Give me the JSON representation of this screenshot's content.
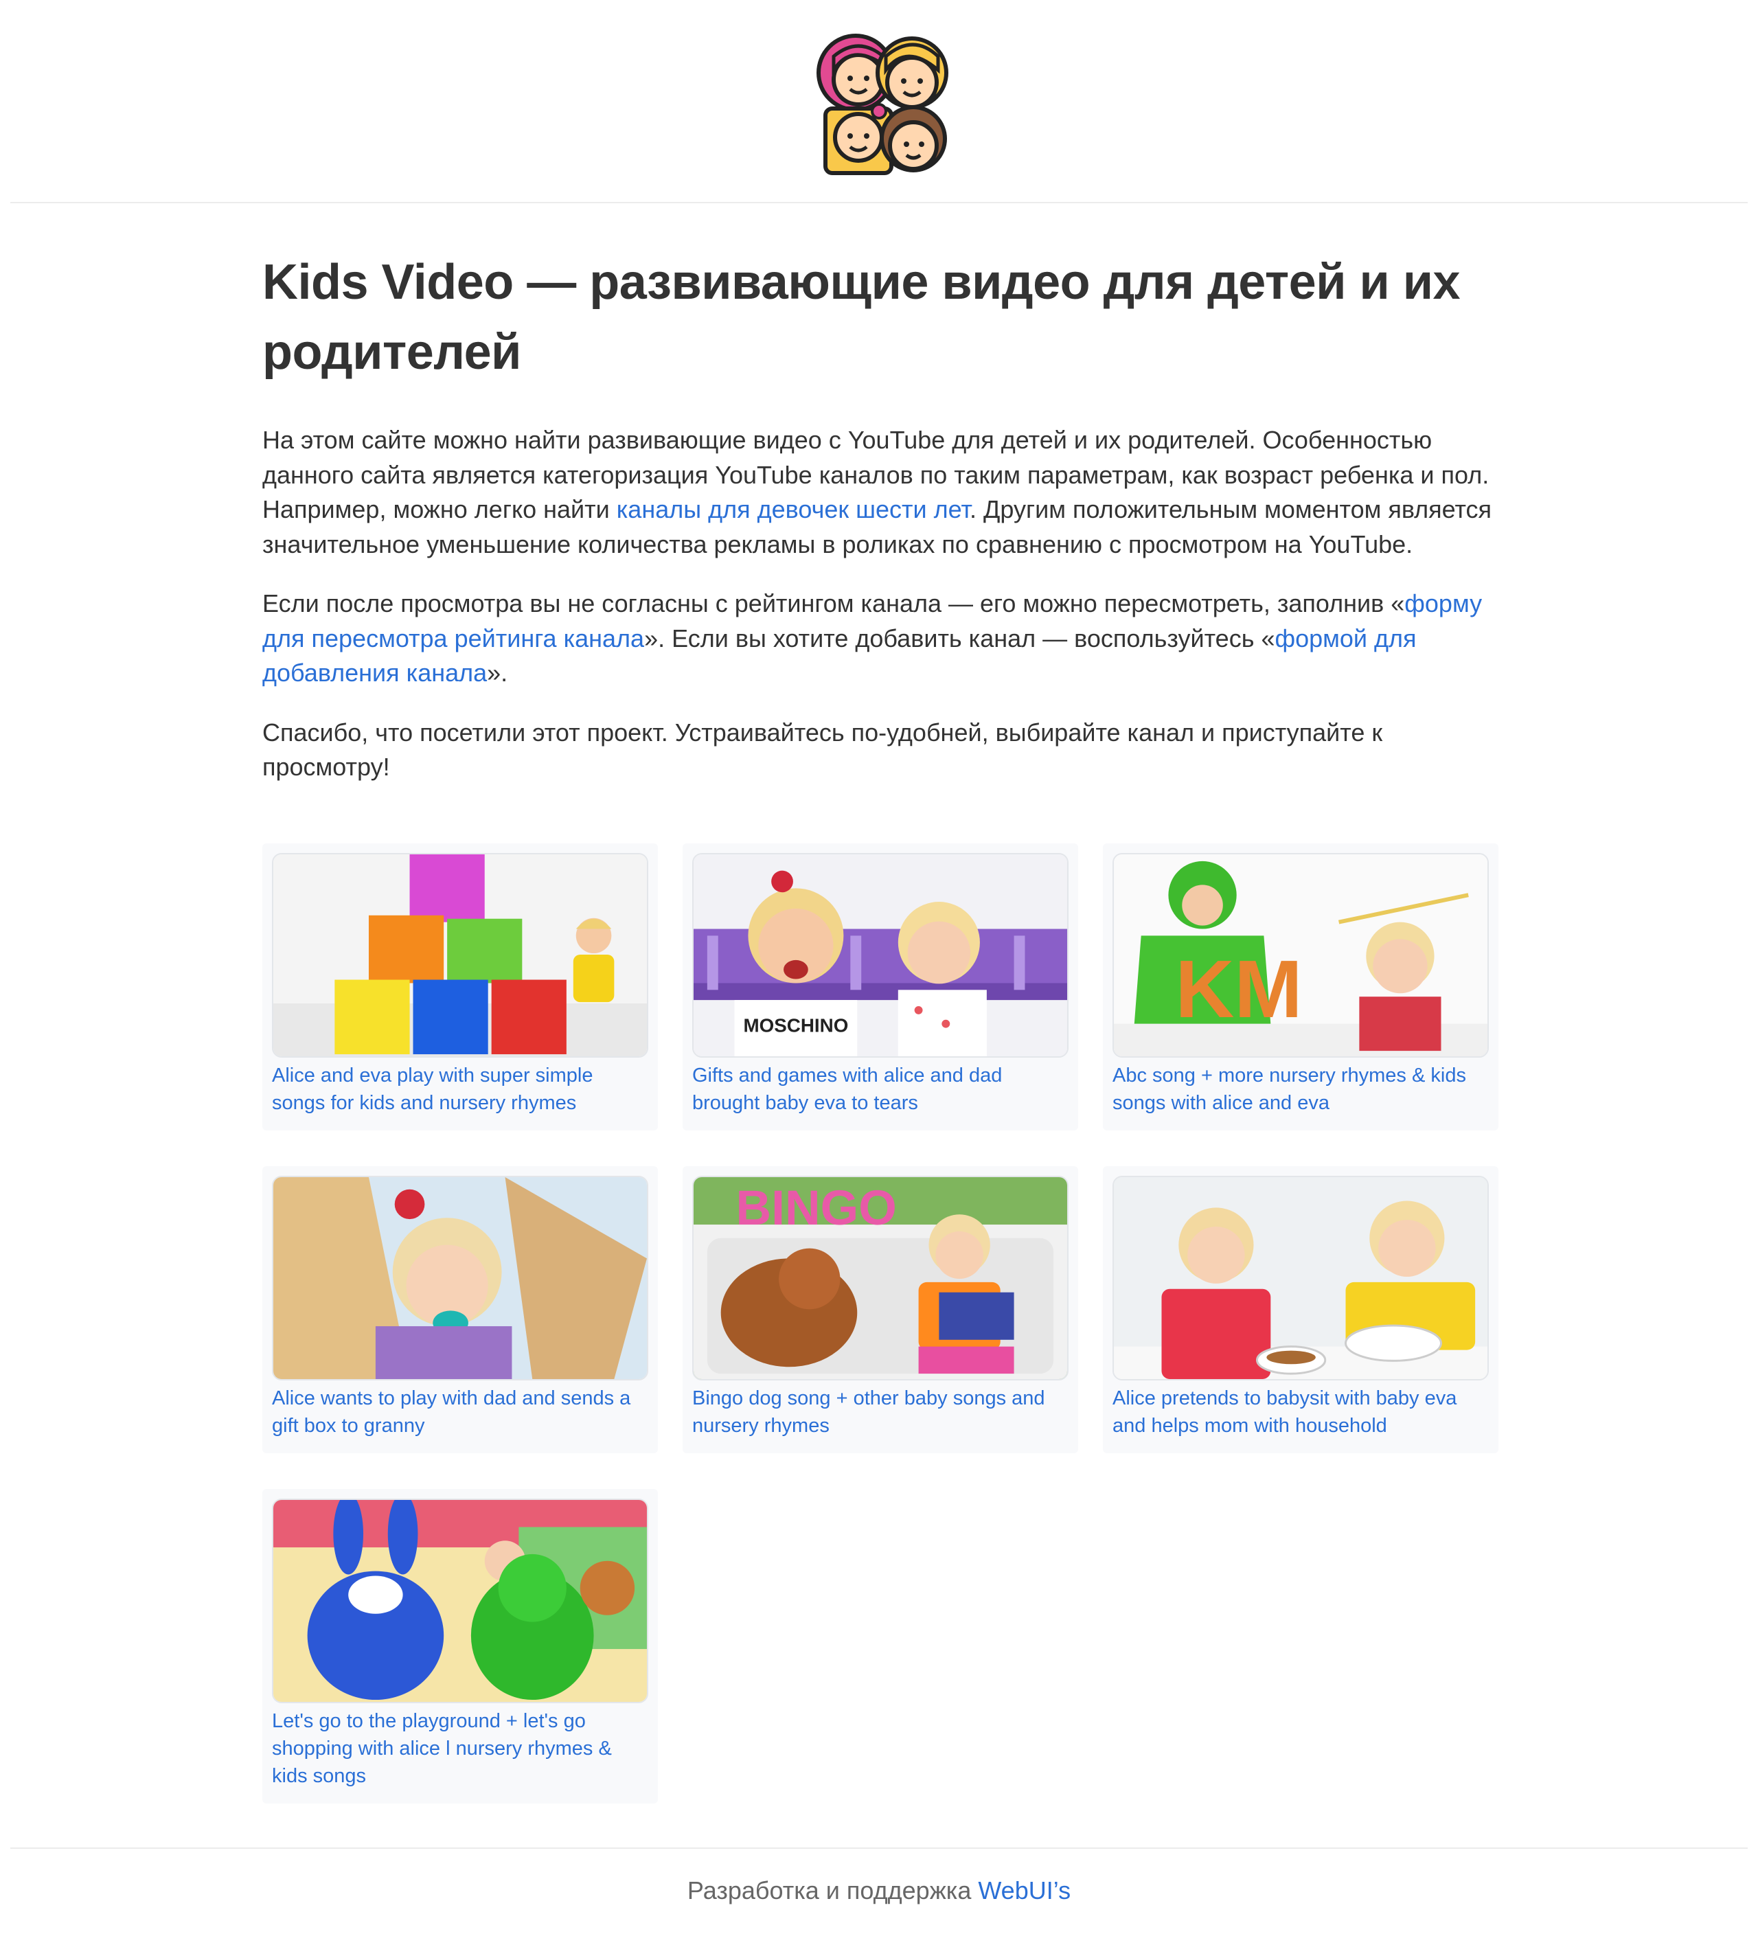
{
  "header": {
    "logo_icon": "family-faces-icon"
  },
  "main": {
    "title": "Kids Video — развивающие видео для детей и их родителей",
    "p1_before": "На этом сайте можно найти развивающие видео с YouTube для детей и их родителей. Особенностью данного сайта является категоризация YouTube каналов по таким параметрам, как возраст ребенка и пол. Например, можно легко найти ",
    "p1_link": "каналы для девочек шести лет",
    "p1_after": ". Другим положительным моментом является значительное уменьшение количества рекламы в роликах по сравнению с просмотром на YouTube.",
    "p2_before": "Если после просмотра вы не согласны с рейтингом канала — его можно пересмотреть, заполнив «",
    "p2_link1": "форму для пересмотра рейтинга канала",
    "p2_middle": "». Если вы хотите добавить канал — воспользуйтесь «",
    "p2_link2": "формой для добавления канала",
    "p2_after": "».",
    "p3": "Спасибо, что посетили этот проект. Устраивайтесь по-удобней, выбирайте канал и приступайте к просмотру!"
  },
  "videos": [
    {
      "title": "Alice and eva play with super simple songs for kids and nursery rhymes"
    },
    {
      "title": "Gifts and games with alice and dad brought baby eva to tears"
    },
    {
      "title": "Abc song + more nursery rhymes & kids songs with alice and eva"
    },
    {
      "title": "Alice wants to play with dad and sends a gift box to granny"
    },
    {
      "title": "Bingo dog song + other baby songs and nursery rhymes"
    },
    {
      "title": "Alice pretends to babysit with baby eva and helps mom with household"
    },
    {
      "title": "Let's go to the playground + let's go shopping with alice l nursery rhymes & kids songs"
    }
  ],
  "thumbnail_text": {
    "v2_shirt": "MOSCHINO",
    "v3_letters": "KM",
    "v5_sign": "BINGO"
  },
  "footer": {
    "text": "Разработка и поддержка ",
    "link": "WebUI’s"
  },
  "colors": {
    "link": "#2a6fd6",
    "text": "#333333",
    "card_bg": "#f8f9fb"
  }
}
